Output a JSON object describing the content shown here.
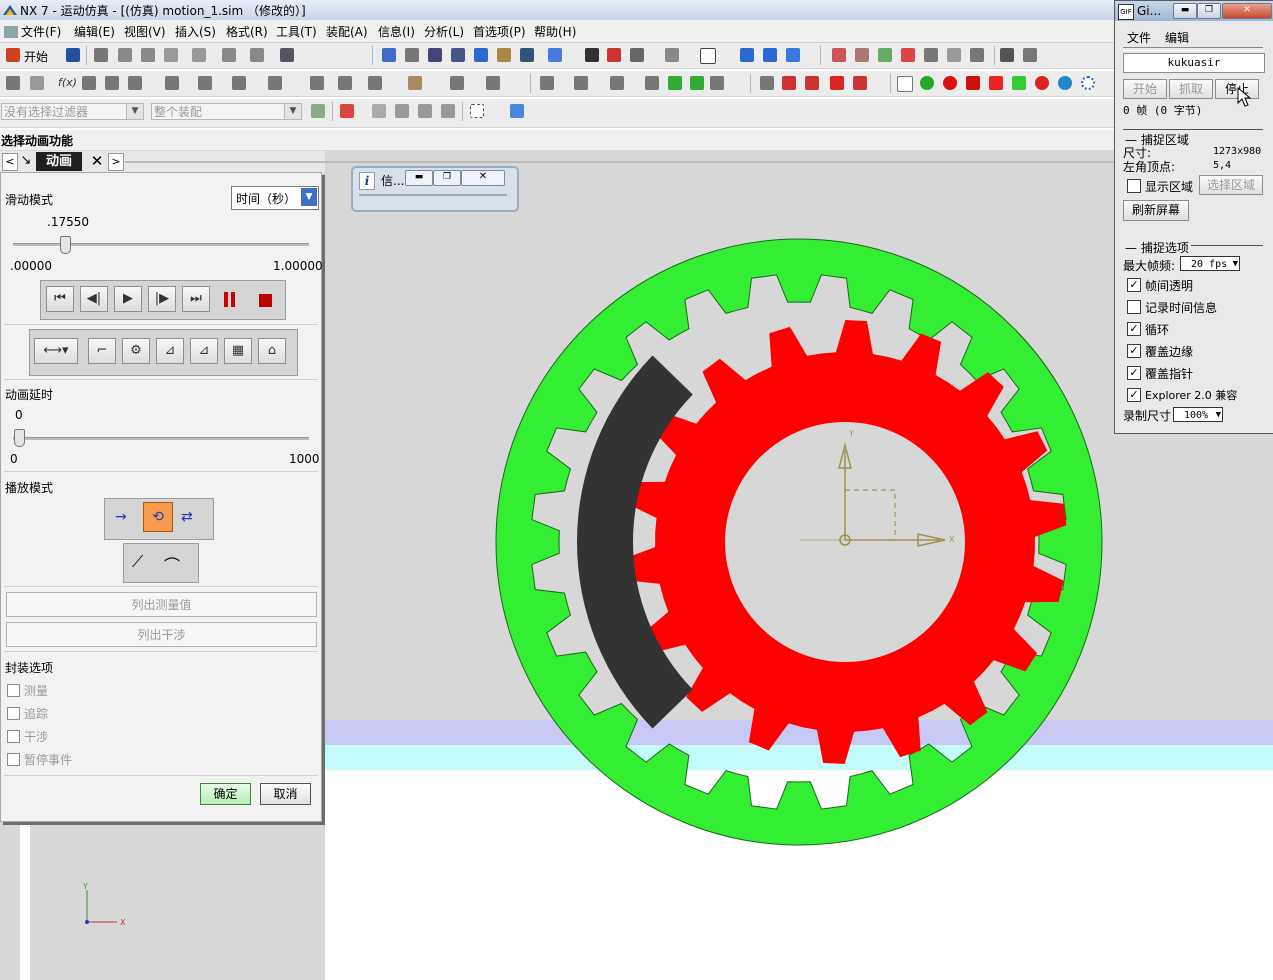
{
  "window": {
    "title": "NX 7 - 运动仿真 - [(仿真) motion_1.sim （修改的）]"
  },
  "menu": [
    "文件(F)",
    "编辑(E)",
    "视图(V)",
    "插入(S)",
    "格式(R)",
    "工具(T)",
    "装配(A)",
    "信息(I)",
    "分析(L)",
    "首选项(P)",
    "帮助(H)"
  ],
  "toolbar": {
    "start_label": "开始",
    "filter_placeholder": "没有选择过滤器",
    "assembly_placeholder": "整个装配"
  },
  "panel": {
    "header": "选择动画功能",
    "tab": "动画",
    "slide_mode_label": "滑动模式",
    "slide_mode_value": "时间（秒）",
    "slider_value": ".17550",
    "slider_fraction": 0.1755,
    "slider_min": ".00000",
    "slider_max": "1.00000",
    "delay_label": "动画延时",
    "delay_value": "0",
    "delay_min": "0",
    "delay_max": "1000",
    "play_mode_label": "播放模式",
    "list_measure": "列出测量值",
    "list_interference": "列出干涉",
    "package_label": "封装选项",
    "options": [
      "测量",
      "追踪",
      "干涉",
      "暂停事件"
    ],
    "ok": "确定",
    "cancel": "取消"
  },
  "info_window": {
    "title": "信..."
  },
  "gif": {
    "title": "Gi...",
    "menu": [
      "文件",
      "编辑"
    ],
    "name": "kukuasir",
    "btn_start": "开始",
    "btn_capture": "抓取",
    "btn_stop": "停止",
    "frames": "0 帧 (0 字节)",
    "section_capture": "捕捉区域",
    "size_label": "尺寸:",
    "size_value": "1273x980",
    "corner_label": "左角顶点:",
    "corner_value": "5,4",
    "show_region": "显示区域",
    "select_region": "选择区域",
    "refresh": "刷新屏幕",
    "section_options": "捕捉选项",
    "max_fps_label": "最大帧频:",
    "max_fps_value": "20 fps",
    "opt_transparent": "帧间透明",
    "opt_record_time": "记录时间信息",
    "opt_loop": "循环",
    "opt_edge": "覆盖边缘",
    "opt_cursor": "覆盖指针",
    "opt_explorer": "Explorer 2.0 兼容",
    "rec_size_label": "录制尺寸",
    "rec_size_value": "100%"
  },
  "axis": {
    "x": "X",
    "y": "Y"
  },
  "colors": {
    "outer_gear": "#33ee33",
    "inner_gear": "#ff0000",
    "carrier": "#333333",
    "viewport_bg": "#d7d7d7"
  }
}
